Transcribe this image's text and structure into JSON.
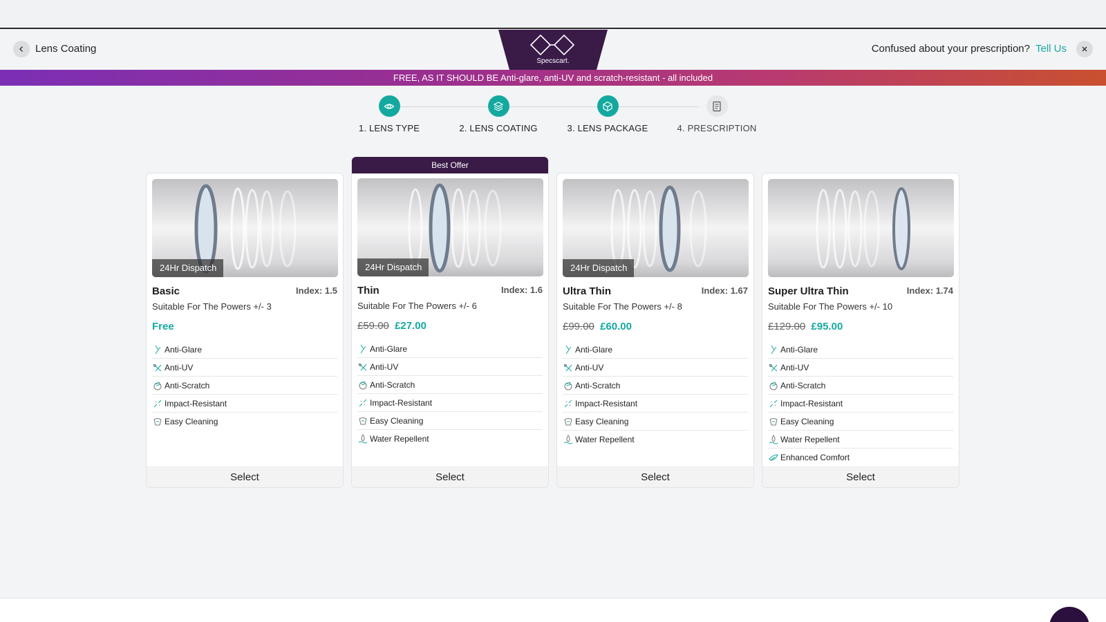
{
  "header": {
    "back_label": "Lens Coating",
    "logo_text": "Specscart.",
    "confused_text": "Confused about your prescription?",
    "tell_us": "Tell Us"
  },
  "banner": {
    "text": "FREE, AS IT SHOULD BE Anti-glare, anti-UV and scratch-resistant - all included"
  },
  "steps": [
    {
      "label": "1. LENS TYPE",
      "icon": "eye-icon",
      "state": "done"
    },
    {
      "label": "2. LENS COATING",
      "icon": "layers-icon",
      "state": "done"
    },
    {
      "label": "3. LENS PACKAGE",
      "icon": "box-icon",
      "state": "done"
    },
    {
      "label": "4. PRESCRIPTION",
      "icon": "document-icon",
      "state": "todo"
    }
  ],
  "best_offer_label": "Best Offer",
  "select_label": "Select",
  "cards": [
    {
      "name": "Basic",
      "index": "Index: 1.5",
      "suitable": "Suitable For The Powers +/- 3",
      "price_free": "Free",
      "dispatch": "24Hr Dispatch",
      "features": [
        "Anti-Glare",
        "Anti-UV",
        "Anti-Scratch",
        "Impact-Resistant",
        "Easy Cleaning"
      ]
    },
    {
      "name": "Thin",
      "index": "Index: 1.6",
      "suitable": "Suitable For The Powers +/- 6",
      "old_price": "£59.00",
      "new_price": "£27.00",
      "dispatch": "24Hr Dispatch",
      "features": [
        "Anti-Glare",
        "Anti-UV",
        "Anti-Scratch",
        "Impact-Resistant",
        "Easy Cleaning",
        "Water Repellent"
      ]
    },
    {
      "name": "Ultra Thin",
      "index": "Index: 1.67",
      "suitable": "Suitable For The Powers +/- 8",
      "old_price": "£99.00",
      "new_price": "£60.00",
      "dispatch": "24Hr Dispatch",
      "features": [
        "Anti-Glare",
        "Anti-UV",
        "Anti-Scratch",
        "Impact-Resistant",
        "Easy Cleaning",
        "Water Repellent"
      ]
    },
    {
      "name": "Super Ultra Thin",
      "index": "Index: 1.74",
      "suitable": "Suitable For The Powers +/- 10",
      "old_price": "£129.00",
      "new_price": "£95.00",
      "features": [
        "Anti-Glare",
        "Anti-UV",
        "Anti-Scratch",
        "Impact-Resistant",
        "Easy Cleaning",
        "Water Repellent",
        "Enhanced Comfort"
      ]
    }
  ],
  "colors": {
    "accent": "#14a99f",
    "brand_dark": "#3a1a47"
  }
}
